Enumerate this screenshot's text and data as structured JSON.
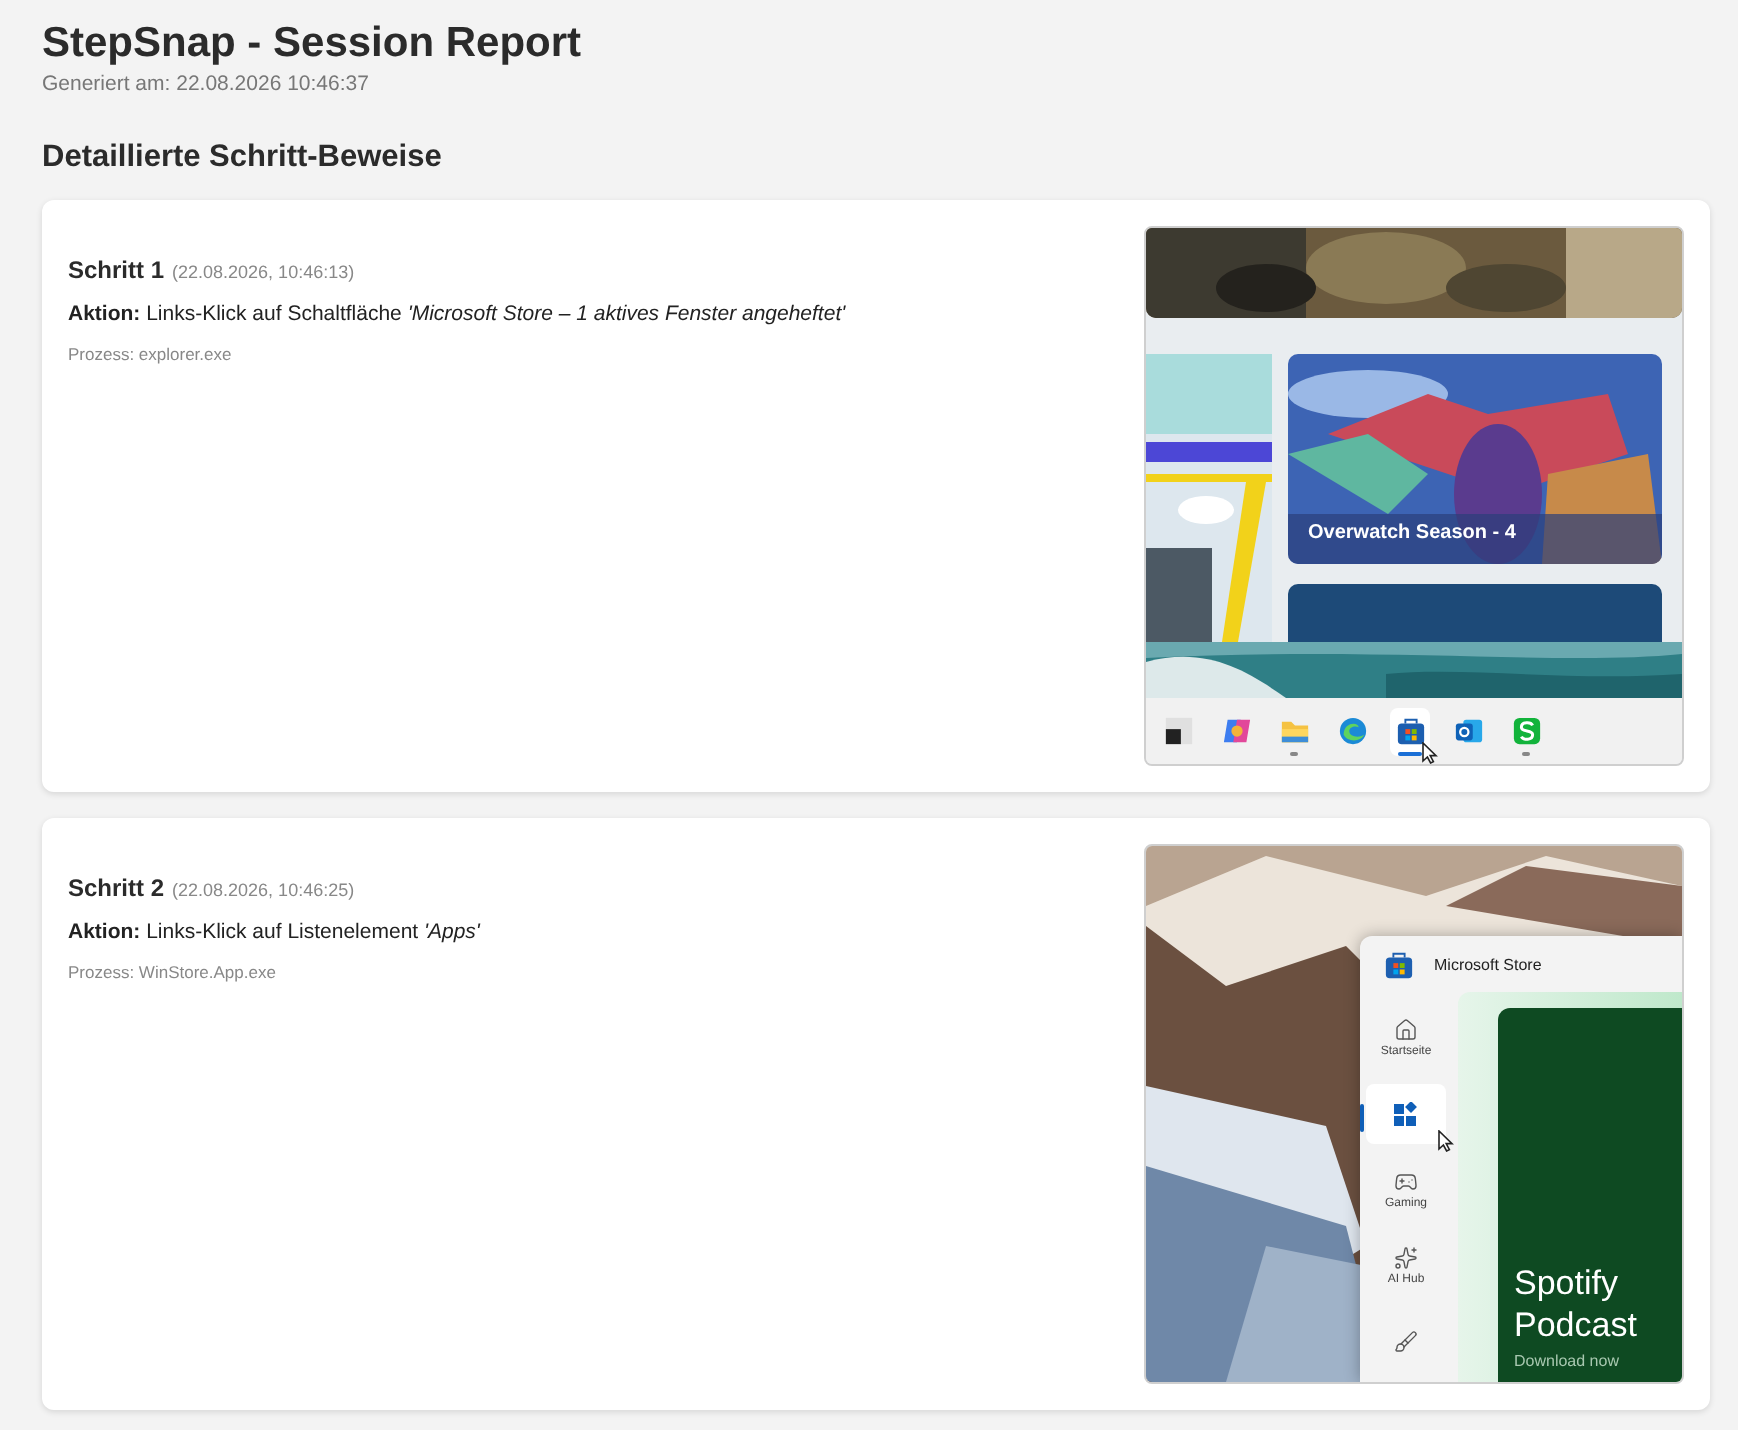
{
  "title": "StepSnap - Session Report",
  "generated": "Generiert am: 22.08.2026 10:46:37",
  "section_title": "Detaillierte Schritt-Beweise",
  "steps": [
    {
      "title": "Schritt 1",
      "time": "(22.08.2026, 10:46:13)",
      "action": "**Aktion:** Links-Klick auf Schaltfläche *'Microsoft Store – 1 aktives Fenster angeheftet'*",
      "process": "Prozess: explorer.exe",
      "screenshot": {
        "kind": "taskbar",
        "tile_caption": "Overwatch Season - 4",
        "taskbar": [
          {
            "kind": "widgets",
            "running": false,
            "selected": false
          },
          {
            "kind": "copilot",
            "running": false,
            "selected": false
          },
          {
            "kind": "folder",
            "running": true,
            "selected": false
          },
          {
            "kind": "edge",
            "running": false,
            "selected": false
          },
          {
            "kind": "store",
            "running": true,
            "selected": true
          },
          {
            "kind": "outlook",
            "running": false,
            "selected": false
          },
          {
            "kind": "green",
            "running": true,
            "selected": false
          }
        ]
      }
    },
    {
      "title": "Schritt 2",
      "time": "(22.08.2026, 10:46:25)",
      "action": "**Aktion:** Links-Klick auf Listenelement *'Apps'*",
      "process": "Prozess: WinStore.App.exe",
      "screenshot": {
        "kind": "store",
        "app_title": "Microsoft Store",
        "nav": [
          {
            "kind": "home",
            "label": "Startseite",
            "selected": false
          },
          {
            "kind": "apps",
            "selected": true
          },
          {
            "kind": "gaming",
            "label": "Gaming",
            "selected": false
          },
          {
            "kind": "ai",
            "label": "AI Hub",
            "selected": false
          },
          {
            "kind": "brush",
            "selected": false
          }
        ],
        "banner_lines": [
          "Spotify",
          "Podcast"
        ],
        "banner_sub": "Download now"
      }
    }
  ]
}
